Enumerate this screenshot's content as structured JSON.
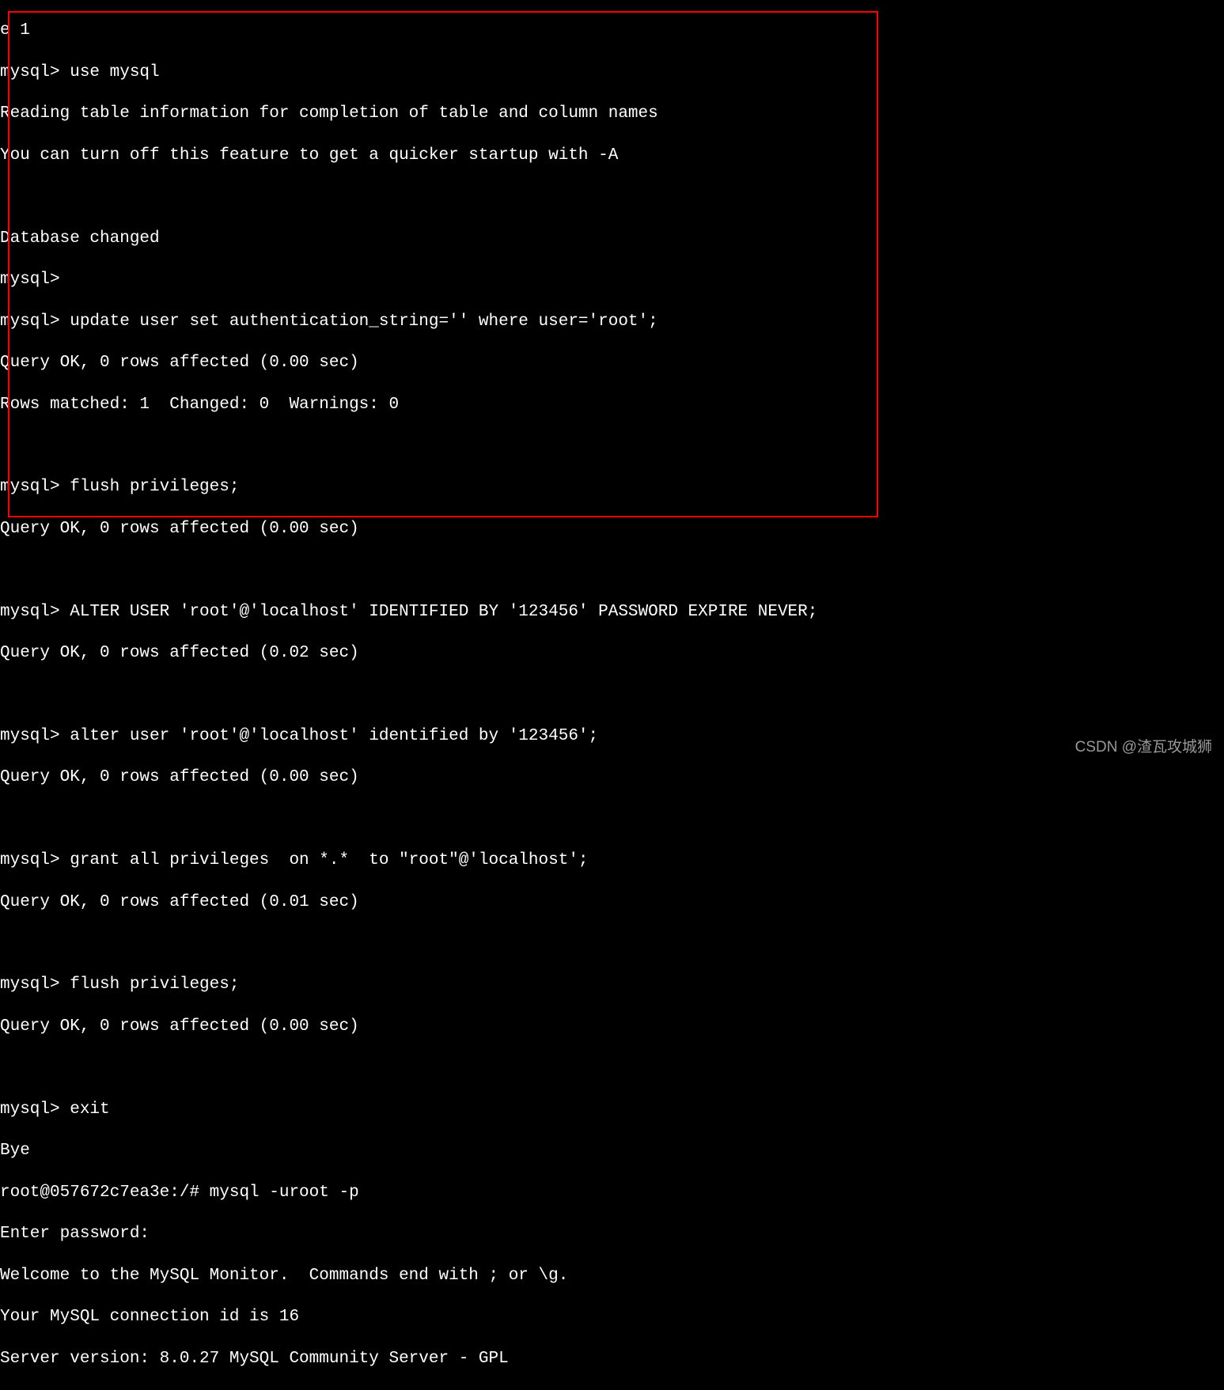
{
  "lines": {
    "l0": "e 1",
    "l1": "mysql> use mysql",
    "l2": "Reading table information for completion of table and column names",
    "l3": "You can turn off this feature to get a quicker startup with -A",
    "l4": "",
    "l5": "Database changed",
    "l6": "mysql>",
    "l7": "mysql> update user set authentication_string='' where user='root';",
    "l8": "Query OK, 0 rows affected (0.00 sec)",
    "l9": "Rows matched: 1  Changed: 0  Warnings: 0",
    "l10": "",
    "l11": "mysql> flush privileges;",
    "l12": "Query OK, 0 rows affected (0.00 sec)",
    "l13": "",
    "l14": "mysql> ALTER USER 'root'@'localhost' IDENTIFIED BY '123456' PASSWORD EXPIRE NEVER;",
    "l15": "Query OK, 0 rows affected (0.02 sec)",
    "l16": "",
    "l17": "mysql> alter user 'root'@'localhost' identified by '123456';",
    "l18": "Query OK, 0 rows affected (0.00 sec)",
    "l19": "",
    "l20": "mysql> grant all privileges  on *.*  to \"root\"@'localhost';",
    "l21": "Query OK, 0 rows affected (0.01 sec)",
    "l22": "",
    "l23": "mysql> flush privileges;",
    "l24": "Query OK, 0 rows affected (0.00 sec)",
    "l25": "",
    "l26": "mysql> exit",
    "l27": "Bye",
    "l28": "root@057672c7ea3e:/# mysql -uroot -p",
    "l29": "Enter password:",
    "l30": "Welcome to the MySQL Monitor.  Commands end with ; or \\g.",
    "l31": "Your MySQL connection id is 16",
    "l32": "Server version: 8.0.27 MySQL Community Server - GPL"
  },
  "watermark": "CSDN @渣瓦攻城狮"
}
